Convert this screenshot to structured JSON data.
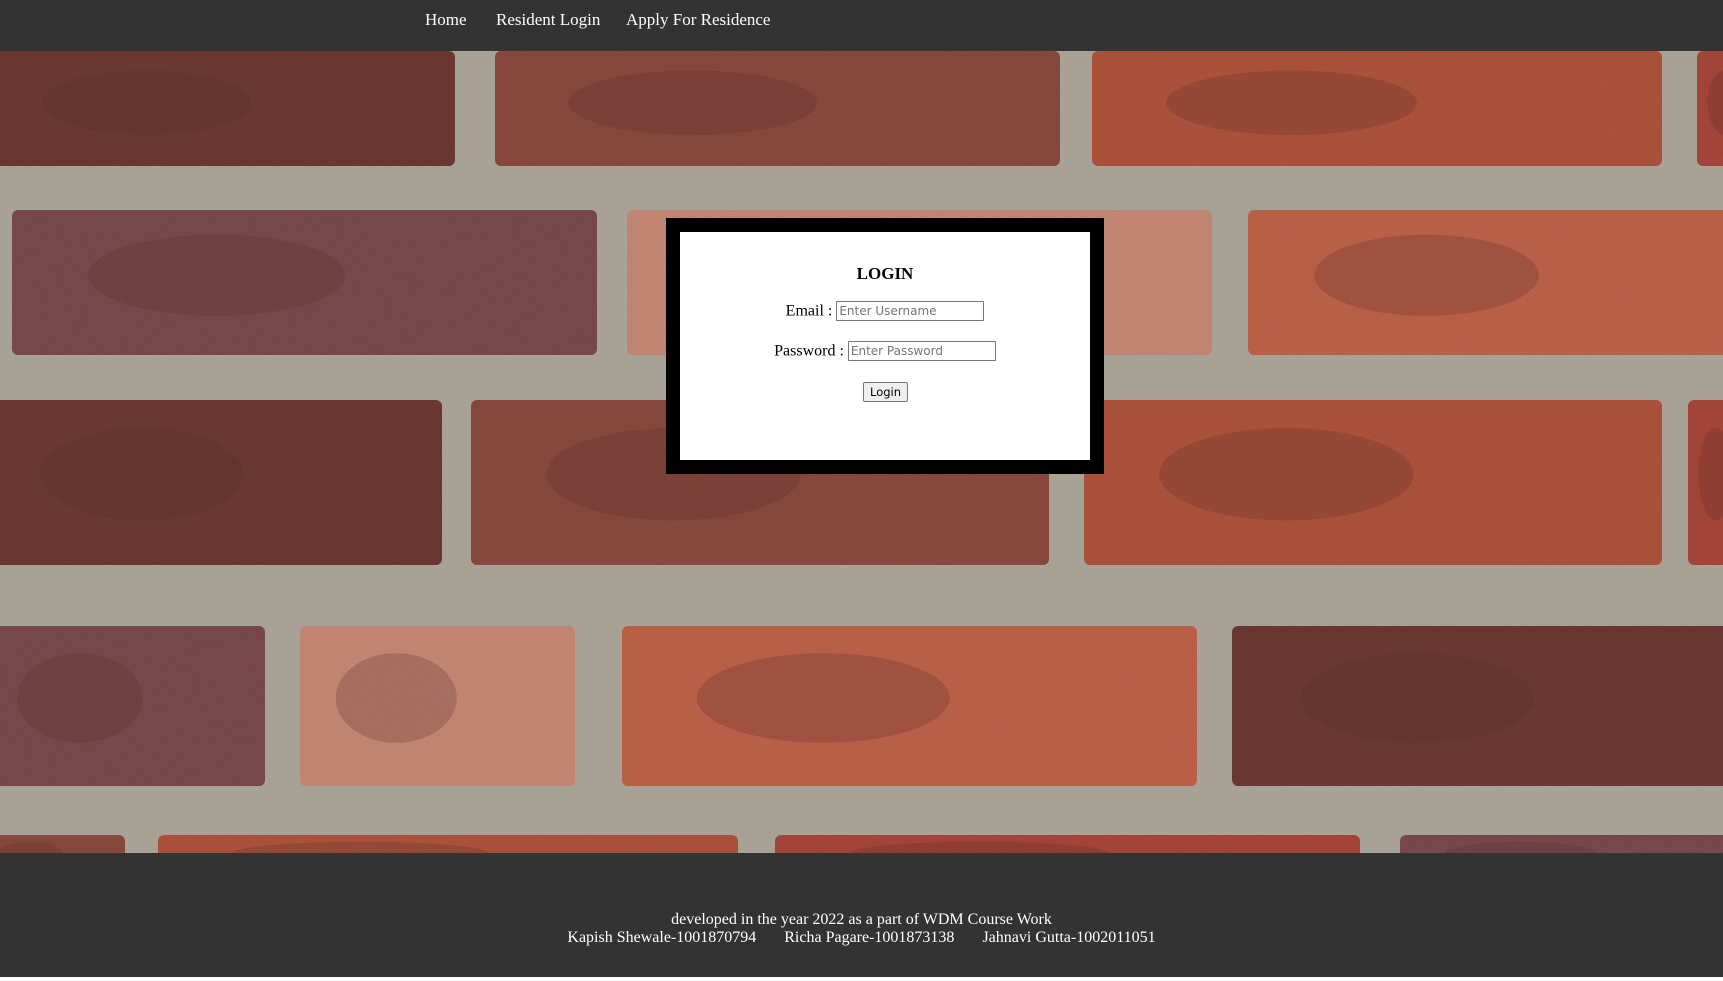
{
  "nav": {
    "items": [
      {
        "label": "Home"
      },
      {
        "label": "Resident Login"
      },
      {
        "label": "Apply For Residence"
      }
    ]
  },
  "login": {
    "title": "LOGIN",
    "email_label": "Email :",
    "email_placeholder": "Enter Username",
    "email_value": "",
    "password_label": "Password :",
    "password_placeholder": "Enter Password",
    "password_value": "",
    "button_label": "Login"
  },
  "footer": {
    "line1": "developed in the year 2022 as a part of WDM Course Work",
    "credits": [
      "Kapish Shewale-1001870794",
      "Richa Pagare-1001873138",
      "Jahnavi Gutta-1002011051"
    ]
  },
  "colors": {
    "bar_background": "#333333",
    "mortar": "#a7a196",
    "brick_red": "#b0543d",
    "brick_dark": "#6e3a33",
    "brick_light": "#c98a77",
    "login_frame": "#000000"
  }
}
